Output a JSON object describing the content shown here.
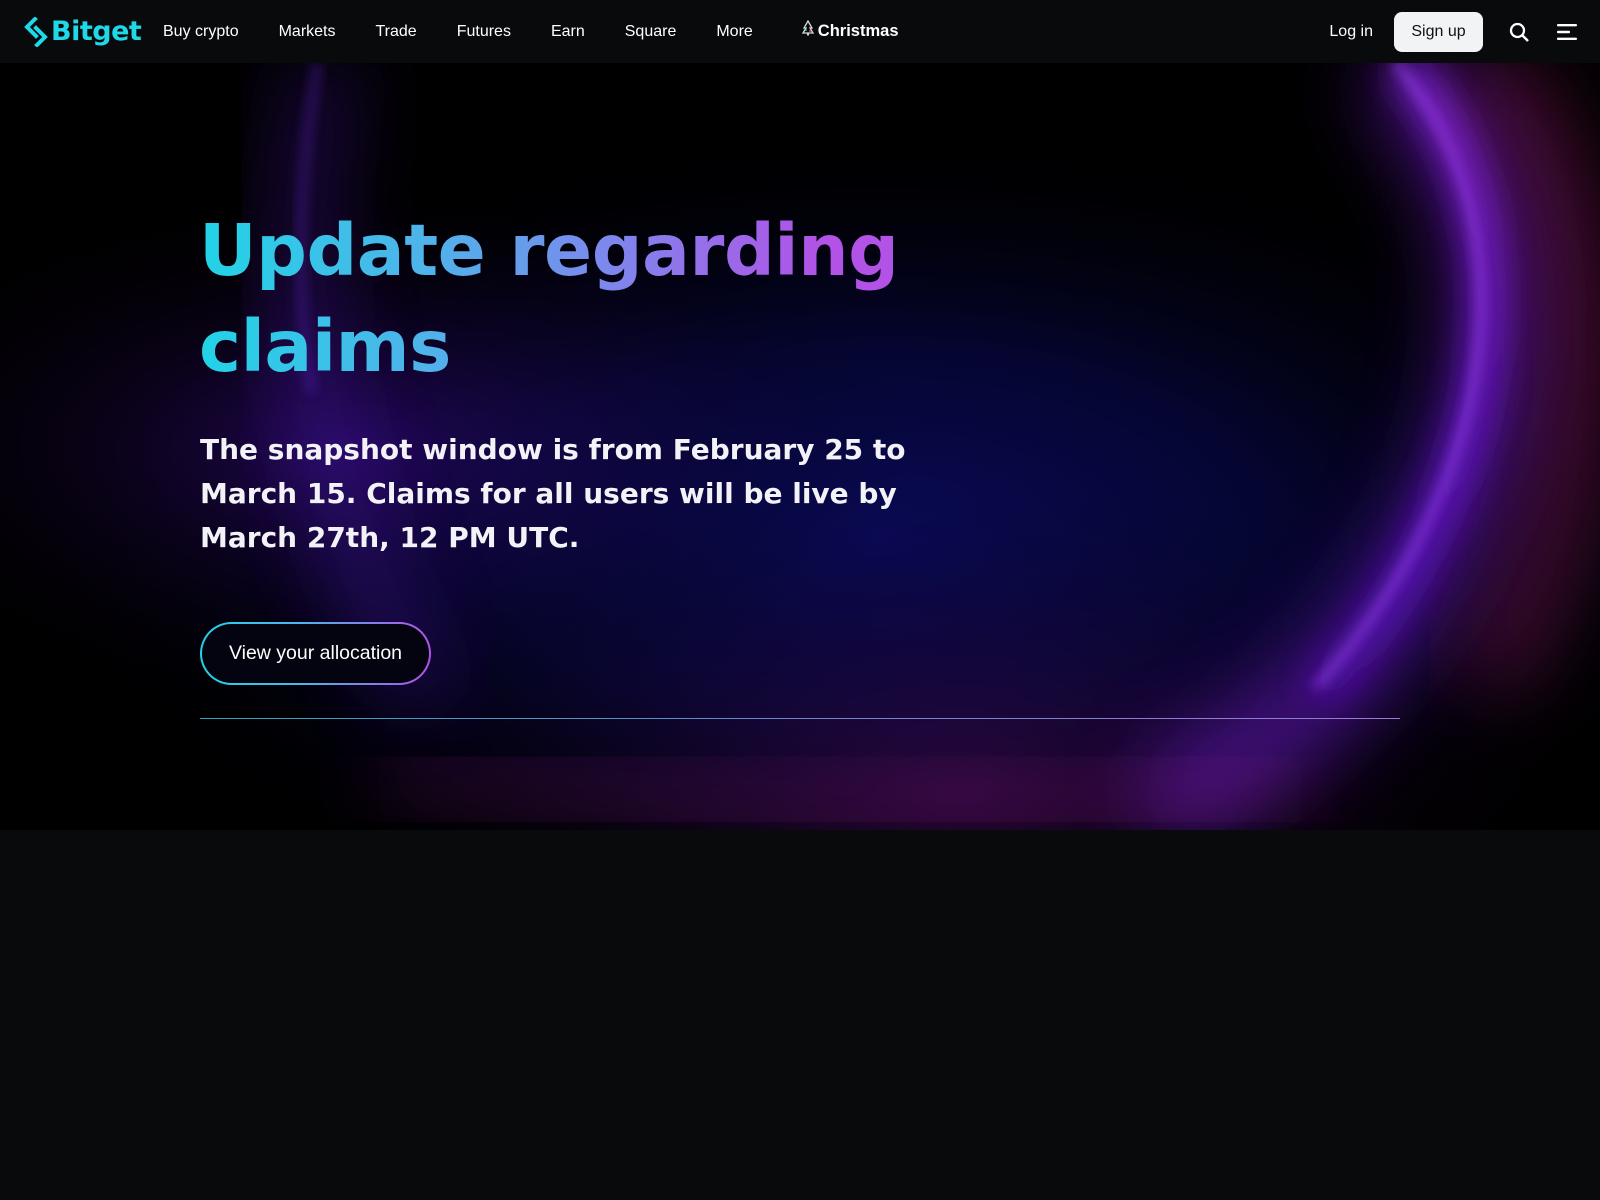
{
  "brand": {
    "name": "Bitget",
    "accent": "#1fd9e8"
  },
  "nav": {
    "links": [
      {
        "label": "Buy crypto"
      },
      {
        "label": "Markets"
      },
      {
        "label": "Trade"
      },
      {
        "label": "Futures"
      },
      {
        "label": "Earn"
      },
      {
        "label": "Square"
      },
      {
        "label": "More"
      }
    ],
    "promo_label": "Christmas",
    "promo_icon": "christmas-tree-icon",
    "login_label": "Log in",
    "signup_label": "Sign up",
    "search_icon": "search-icon",
    "menu_icon": "hamburger-menu-icon"
  },
  "hero": {
    "title": "Update regarding claims",
    "subtitle": "The snapshot window is from February 25 to March 15. Claims for all users will be live by March 27th, 12 PM UTC.",
    "cta_label": "View your allocation",
    "gradient": [
      "#22d3e6",
      "#b252e6"
    ]
  }
}
